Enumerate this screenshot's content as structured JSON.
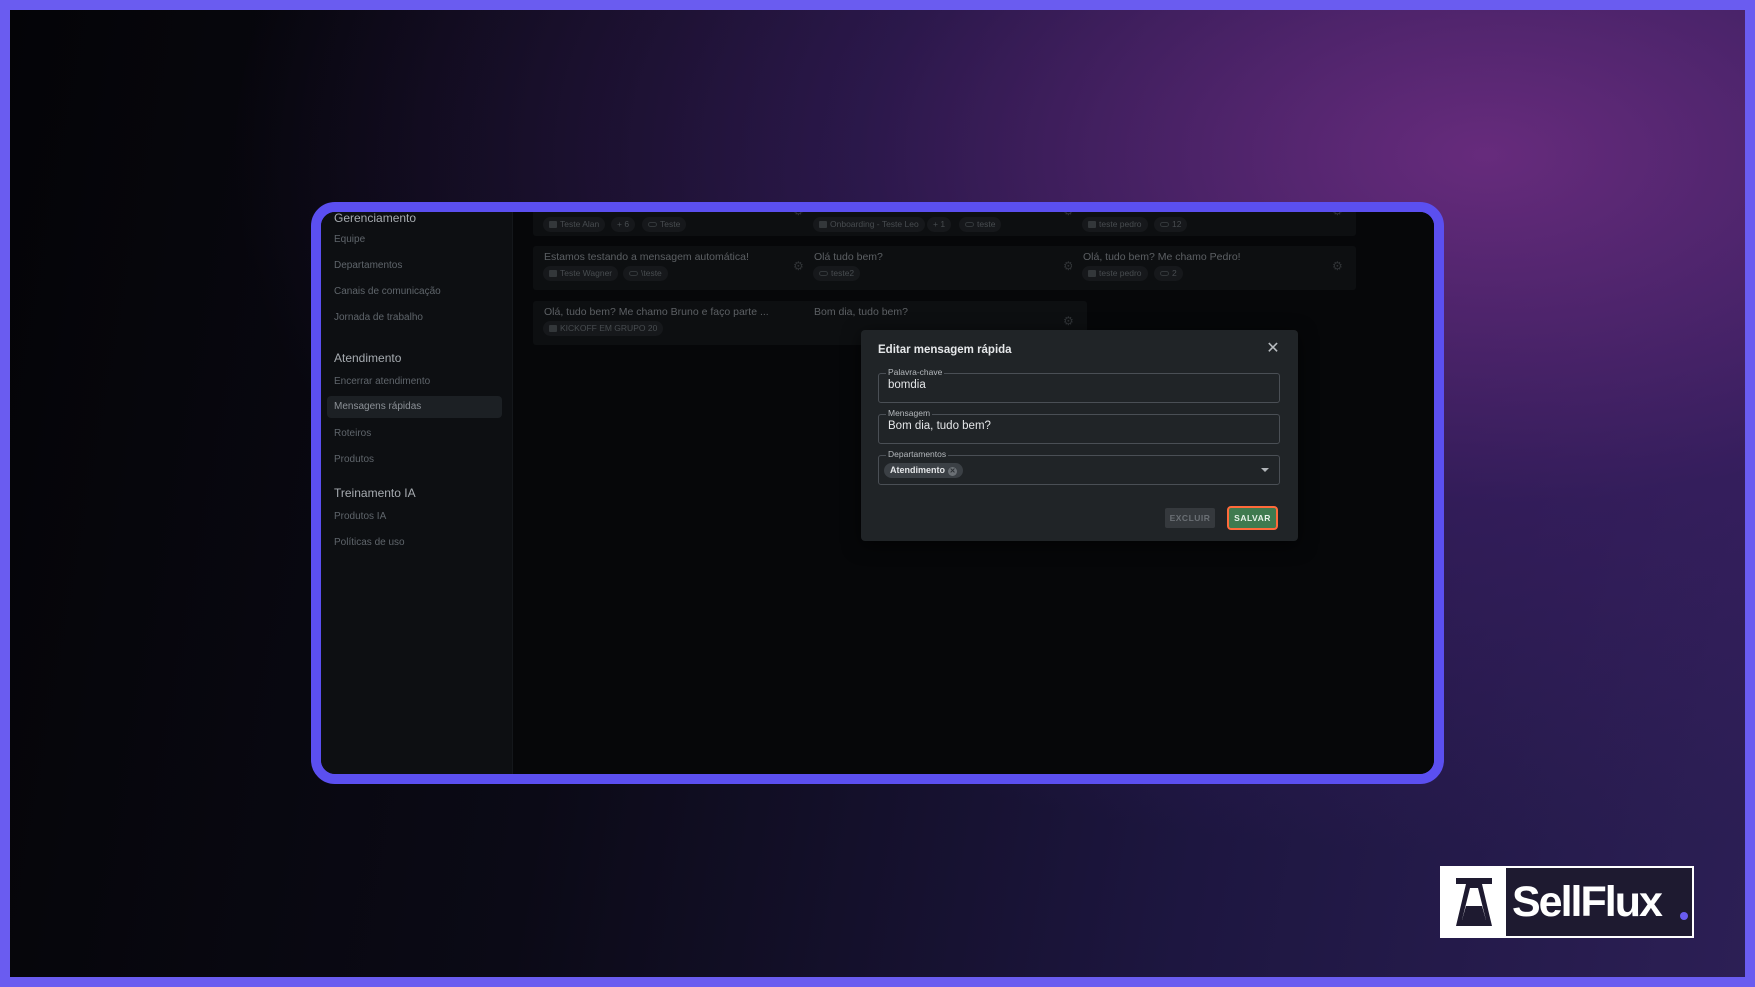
{
  "sidebar": {
    "sections": [
      {
        "title": "Gerenciamento",
        "items": [
          "Equipe",
          "Departamentos",
          "Canais de comunicação",
          "Jornada de trabalho"
        ]
      },
      {
        "title": "Atendimento",
        "items": [
          "Encerrar atendimento",
          "Mensagens rápidas",
          "Roteiros",
          "Produtos"
        ]
      },
      {
        "title": "Treinamento IA",
        "items": [
          "Produtos IA",
          "Políticas de uso"
        ]
      }
    ],
    "active_item": "Mensagens rápidas"
  },
  "cards": [
    {
      "message": "",
      "dept": "Teste Alan",
      "extra": "+ 6",
      "tag": "Teste"
    },
    {
      "message": "",
      "dept": "Onboarding - Teste Leo",
      "extra": "+ 1",
      "tag": "teste"
    },
    {
      "message": "",
      "dept": "teste pedro",
      "extra": "",
      "tag": "12"
    },
    {
      "message": "Estamos testando a mensagem automática!",
      "dept": "Teste Wagner",
      "extra": "",
      "tag": "\\teste"
    },
    {
      "message": "Olá tudo bem?",
      "dept": "",
      "extra": "",
      "tag": "teste2"
    },
    {
      "message": "Olá, tudo bem? Me chamo Pedro!",
      "dept": "teste pedro",
      "extra": "",
      "tag": "2"
    },
    {
      "message": "Olá, tudo bem? Me chamo Bruno e faço parte ...",
      "dept": "KICKOFF EM GRUPO 20",
      "extra": "",
      "tag": ""
    },
    {
      "message": "Bom dia, tudo bem?",
      "dept": "",
      "extra": "",
      "tag": ""
    }
  ],
  "modal": {
    "title": "Editar mensagem rápida",
    "keyword_label": "Palavra-chave",
    "keyword_value": "bomdia",
    "message_label": "Mensagem",
    "message_value": "Bom dia, tudo bem?",
    "departments_label": "Departamentos",
    "department_chip": "Atendimento",
    "delete_label": "EXCLUIR",
    "save_label": "SALVAR"
  },
  "brand": {
    "name": "SellFlux",
    "accent": "#6a5cf0"
  }
}
